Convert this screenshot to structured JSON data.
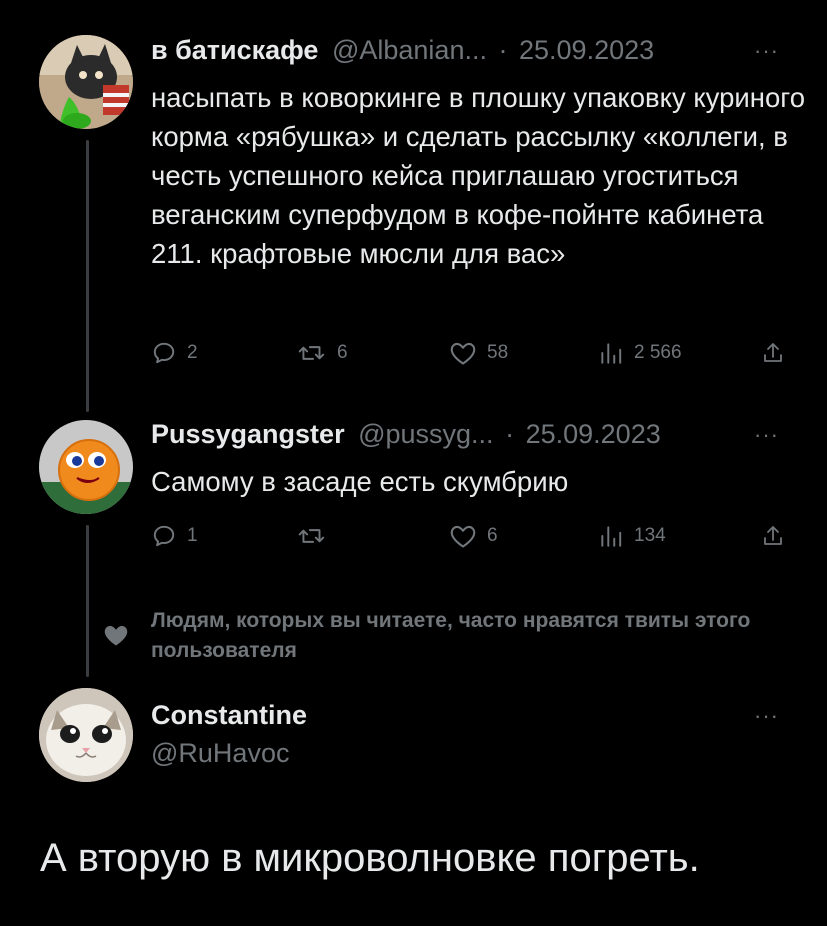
{
  "tweets": [
    {
      "display_name": "в батискафе",
      "handle": "@Albanian...",
      "separator": "·",
      "date": "25.09.2023",
      "more": "···",
      "text": "насыпать в коворкинге в плошку упаковку куриного корма «рябушка» и сделать рассылку «коллеги, в честь успешного кейса приглашаю угоститься веганским суперфудом в кофе-пойнте кабинета 211. крафтовые мюсли для вас»",
      "actions": {
        "replies": "2",
        "retweets": "6",
        "likes": "58",
        "views": "2 566"
      }
    },
    {
      "display_name": "Pussygangster",
      "handle": "@pussyg...",
      "separator": "·",
      "date": "25.09.2023",
      "more": "···",
      "text": "Самому в засаде есть скумбрию",
      "actions": {
        "replies": "1",
        "retweets": "",
        "likes": "6",
        "views": "134"
      }
    }
  ],
  "social_context": {
    "text": "Людям, которых вы читаете, часто нравятся твиты этого пользователя"
  },
  "profile": {
    "display_name": "Constantine",
    "handle": "@RuHavoc",
    "more": "···"
  },
  "reply_text": "А вторую в микроволновке погреть.",
  "colors": {
    "background": "#000000",
    "text": "#e7e9ea",
    "muted": "#71767b",
    "thread_line": "#3a3d41"
  },
  "icons": [
    "reply-icon",
    "retweet-icon",
    "like-icon",
    "views-icon",
    "share-icon",
    "heart-icon"
  ]
}
